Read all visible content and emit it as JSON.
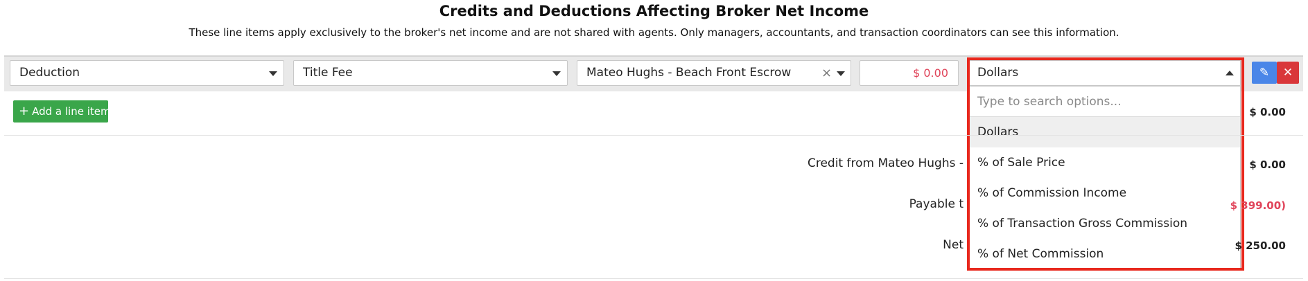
{
  "header": {
    "title": "Credits and Deductions Affecting Broker Net Income",
    "subtitle": "These line items apply exclusively to the broker's net income and are not shared with agents. Only managers, accountants, and transaction coordinators can see this information."
  },
  "line_item": {
    "type_value": "Deduction",
    "category_value": "Title Fee",
    "payee_value": "Mateo Hughs - Beach Front Escrow",
    "amount_value": "$ 0.00",
    "unit_value": "Dollars"
  },
  "unit_dropdown": {
    "search_placeholder": "Type to search options...",
    "options": [
      "Dollars",
      "% of Sale Price",
      "% of Commission Income",
      "% of Transaction Gross Commission",
      "% of Net Commission"
    ],
    "selected_index": 0
  },
  "actions": {
    "add_line_item_label": "Add a line item"
  },
  "summary": {
    "line_total": "$ 0.00",
    "credit_label": "Credit from Mateo Hughs -",
    "credit_value": "$ 0.00",
    "payable_label": "Payable t",
    "payable_value": "$ 399.00)",
    "net_label": "Net",
    "net_value": "$ 250.00"
  },
  "colors": {
    "highlight": "#e8281d",
    "negative": "#e0445a",
    "add_button": "#3aa64a",
    "edit_button": "#4a86e8",
    "delete_button": "#d9373a"
  },
  "icons": {
    "edit": "pencil-icon",
    "delete": "close-icon",
    "add": "plus-icon",
    "caret": "chevron-down-icon",
    "clear": "clear-icon"
  }
}
